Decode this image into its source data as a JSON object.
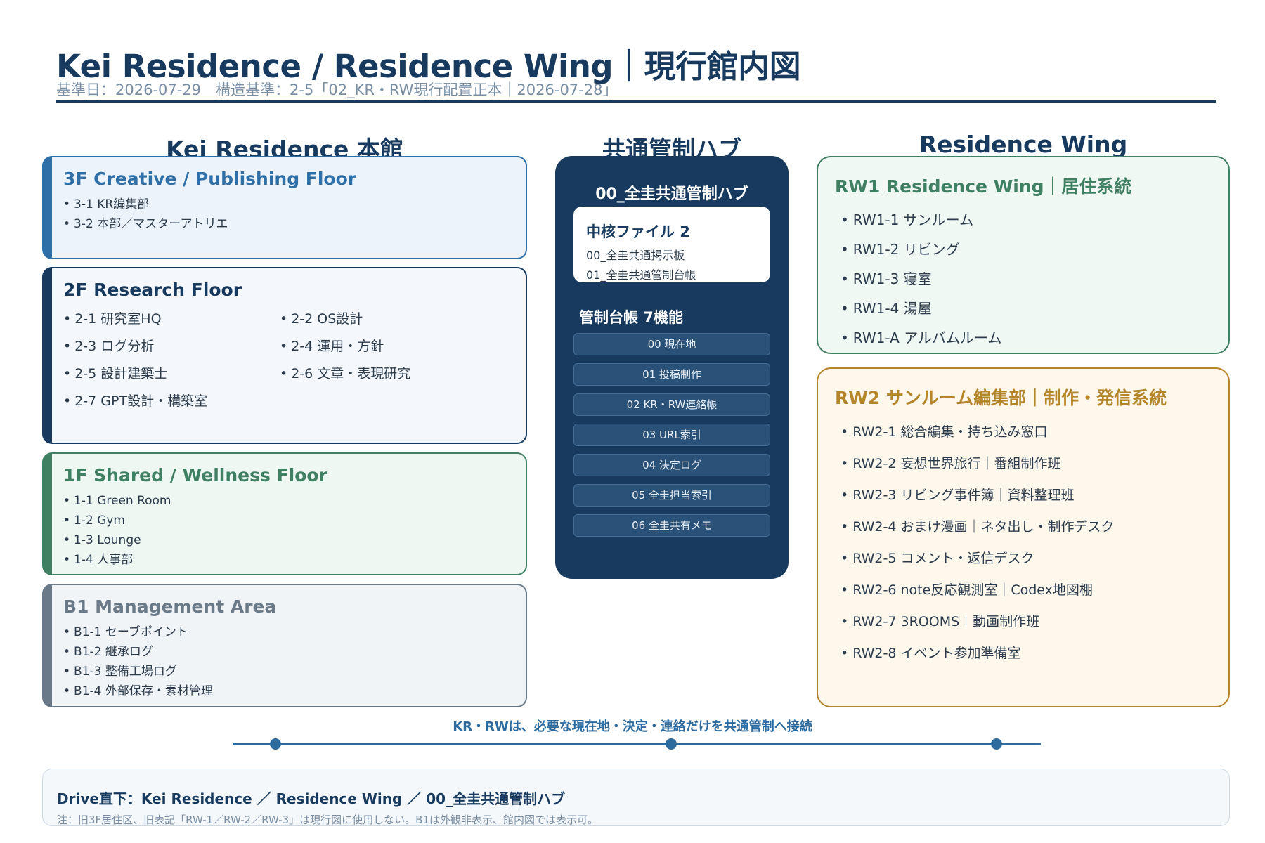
{
  "header": {
    "title": "Kei Residence / Residence Wing｜現行館内図",
    "subtitle": "基準日：2026-07-29　構造基準：2-5「02_KR・RW現行配置正本｜2026-07-28」"
  },
  "columns": {
    "left": "Kei Residence 本館",
    "center": "共通管制ハブ",
    "right": "Residence Wing"
  },
  "floors": {
    "f3": {
      "title": "3F Creative / Publishing Floor",
      "items": [
        "3-1 KR編集部",
        "3-2 本部／マスターアトリエ"
      ]
    },
    "f2": {
      "title": "2F Research Floor",
      "items": [
        "2-1 研究室HQ",
        "2-2 OS設計",
        "2-3 ログ分析",
        "2-4 運用・方針",
        "2-5 設計建築士",
        "2-6 文章・表現研究",
        "2-7 GPT設計・構築室"
      ]
    },
    "f1": {
      "title": "1F Shared / Wellness Floor",
      "items": [
        "1-1 Green Room",
        "1-2 Gym",
        "1-3 Lounge",
        "1-4 人事部"
      ]
    },
    "b1": {
      "title": "B1 Management Area",
      "items": [
        "B1-1 セーブポイント",
        "B1-2 継承ログ",
        "B1-3 整備工場ログ",
        "B1-4 外部保存・素材管理"
      ]
    }
  },
  "hub": {
    "title": "00_全圭共通管制ハブ",
    "core": {
      "title": "中核ファイル 2",
      "items": [
        "00_全圭共通掲示板",
        "01_全圭共通管制台帳"
      ]
    },
    "functions_title": "管制台帳 7機能",
    "functions": [
      "00 現在地",
      "01 投稿制作",
      "02 KR・RW連絡帳",
      "03 URL索引",
      "04 決定ログ",
      "05 全圭担当索引",
      "06 全圭共有メモ"
    ]
  },
  "wing": {
    "rw1": {
      "title": "RW1 Residence Wing｜居住系統",
      "items": [
        "RW1-1 サンルーム",
        "RW1-2 リビング",
        "RW1-3 寝室",
        "RW1-4 湯屋",
        "RW1-A アルバムルーム"
      ]
    },
    "rw2": {
      "title": "RW2 サンルーム編集部｜制作・発信系統",
      "items": [
        "RW2-1 総合編集・持ち込み窓口",
        "RW2-2 妄想世界旅行｜番組制作班",
        "RW2-3 リビング事件簿｜資料整理班",
        "RW2-4 おまけ漫画｜ネタ出し・制作デスク",
        "RW2-5 コメント・返信デスク",
        "RW2-6 note反応観測室｜Codex地図棚",
        "RW2-7 3ROOMS｜動画制作班",
        "RW2-8 イベント参加準備室"
      ]
    }
  },
  "connection": {
    "text": "KR・RWは、必要な現在地・決定・連絡だけを共通管制へ接続"
  },
  "footer": {
    "main": "Drive直下：Kei Residence ／ Residence Wing ／ 00_全圭共通管制ハブ",
    "note": "注：旧3F居住区、旧表記「RW-1／RW-2／RW-3」は現行図に使用しない。B1は外観非表示、館内図では表示可。"
  },
  "colors": {
    "navy": "#173a5e",
    "f3_accent": "#2f6fa8",
    "f1_accent": "#3f7f62",
    "b1_accent": "#6b7a89",
    "rw1_accent": "#3f7f62",
    "rw2_accent": "#b5852a"
  }
}
